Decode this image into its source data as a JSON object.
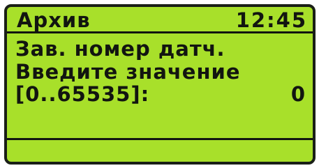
{
  "header": {
    "title": "Архив",
    "time": "12:45"
  },
  "body": {
    "line1": "Зав. номер датч.",
    "line2": "Введите значение",
    "range_label": "[0..65535]:",
    "value": "0"
  }
}
